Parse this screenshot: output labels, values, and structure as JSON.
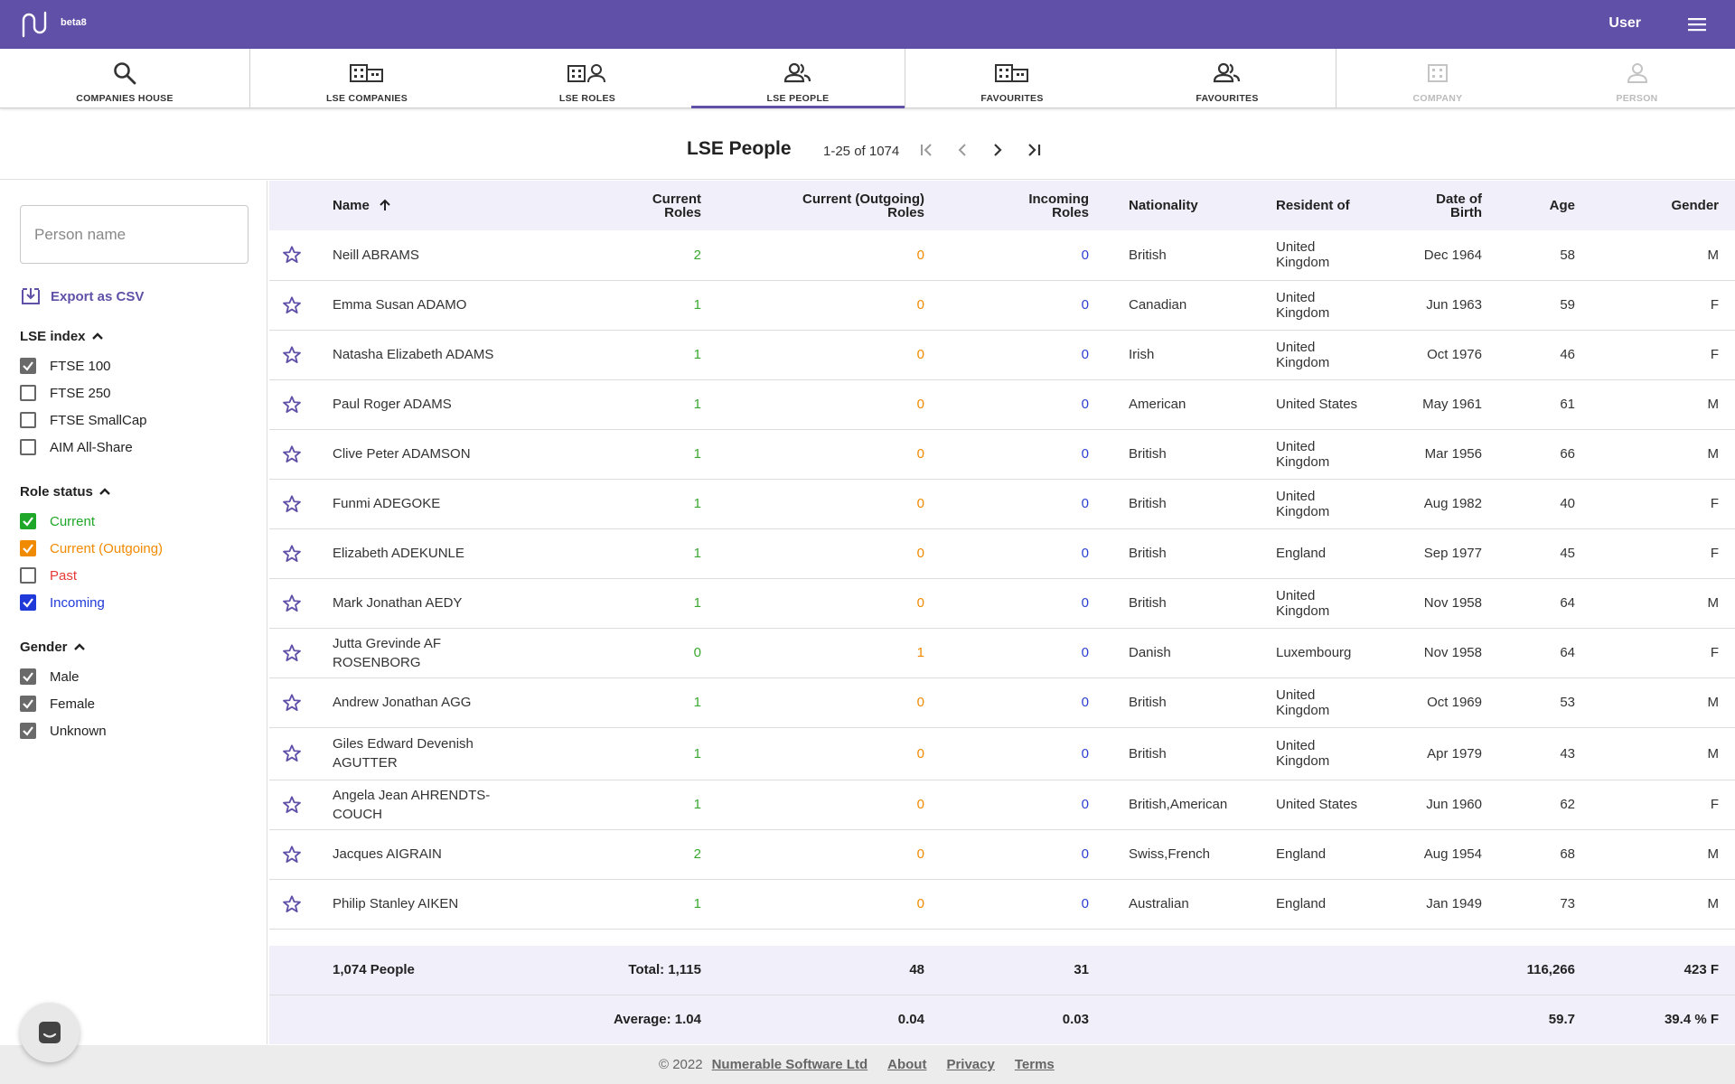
{
  "app": {
    "badge": "beta8",
    "user": "User"
  },
  "nav": {
    "tabs": [
      {
        "label": "COMPANIES HOUSE",
        "icon": "search-icon"
      },
      {
        "label": "LSE COMPANIES",
        "icon": "companies-icon"
      },
      {
        "label": "LSE ROLES",
        "icon": "company-person-icon"
      },
      {
        "label": "LSE PEOPLE",
        "icon": "people-icon",
        "active": true
      },
      {
        "label": "FAVOURITES",
        "icon": "companies-icon"
      },
      {
        "label": "FAVOURITES",
        "icon": "people-icon"
      },
      {
        "label": "COMPANY",
        "icon": "company-icon",
        "disabled": true
      },
      {
        "label": "PERSON",
        "icon": "person-icon",
        "disabled": true
      }
    ]
  },
  "page": {
    "title": "LSE People",
    "range": "1-25 of 1074"
  },
  "sidebar": {
    "search_placeholder": "Person name",
    "export_label": "Export as CSV",
    "lse_index": {
      "title": "LSE index",
      "items": [
        {
          "label": "FTSE 100",
          "checked": true
        },
        {
          "label": "FTSE 250",
          "checked": false
        },
        {
          "label": "FTSE SmallCap",
          "checked": false
        },
        {
          "label": "AIM All-Share",
          "checked": false
        }
      ]
    },
    "role_status": {
      "title": "Role status",
      "items": [
        {
          "label": "Current",
          "checked": true,
          "color": "#1fa72a"
        },
        {
          "label": "Current (Outgoing)",
          "checked": true,
          "color": "#f08a00"
        },
        {
          "label": "Past",
          "checked": false,
          "color": "#e53935"
        },
        {
          "label": "Incoming",
          "checked": true,
          "color": "#1f3ad8"
        }
      ]
    },
    "gender": {
      "title": "Gender",
      "items": [
        {
          "label": "Male",
          "checked": true
        },
        {
          "label": "Female",
          "checked": true
        },
        {
          "label": "Unknown",
          "checked": true
        }
      ]
    }
  },
  "table": {
    "headers": {
      "name": "Name",
      "current_1": "Current",
      "current_2": "Roles",
      "outgoing_1": "Current (Outgoing)",
      "outgoing_2": "Roles",
      "incoming_1": "Incoming",
      "incoming_2": "Roles",
      "nationality": "Nationality",
      "resident": "Resident of",
      "dob_1": "Date of",
      "dob_2": "Birth",
      "age": "Age",
      "gender": "Gender"
    },
    "rows": [
      {
        "name": "Neill ABRAMS",
        "current": "2",
        "outgoing": "0",
        "incoming": "0",
        "nationality": "British",
        "resident": "United Kingdom",
        "dob": "Dec 1964",
        "age": "58",
        "gender": "M"
      },
      {
        "name": "Emma Susan ADAMO",
        "current": "1",
        "outgoing": "0",
        "incoming": "0",
        "nationality": "Canadian",
        "resident": "United Kingdom",
        "dob": "Jun 1963",
        "age": "59",
        "gender": "F"
      },
      {
        "name": "Natasha Elizabeth ADAMS",
        "current": "1",
        "outgoing": "0",
        "incoming": "0",
        "nationality": "Irish",
        "resident": "United Kingdom",
        "dob": "Oct 1976",
        "age": "46",
        "gender": "F"
      },
      {
        "name": "Paul Roger ADAMS",
        "current": "1",
        "outgoing": "0",
        "incoming": "0",
        "nationality": "American",
        "resident": "United States",
        "dob": "May 1961",
        "age": "61",
        "gender": "M"
      },
      {
        "name": "Clive Peter ADAMSON",
        "current": "1",
        "outgoing": "0",
        "incoming": "0",
        "nationality": "British",
        "resident": "United Kingdom",
        "dob": "Mar 1956",
        "age": "66",
        "gender": "M"
      },
      {
        "name": "Funmi ADEGOKE",
        "current": "1",
        "outgoing": "0",
        "incoming": "0",
        "nationality": "British",
        "resident": "United Kingdom",
        "dob": "Aug 1982",
        "age": "40",
        "gender": "F"
      },
      {
        "name": "Elizabeth ADEKUNLE",
        "current": "1",
        "outgoing": "0",
        "incoming": "0",
        "nationality": "British",
        "resident": "England",
        "dob": "Sep 1977",
        "age": "45",
        "gender": "F"
      },
      {
        "name": "Mark Jonathan AEDY",
        "current": "1",
        "outgoing": "0",
        "incoming": "0",
        "nationality": "British",
        "resident": "United Kingdom",
        "dob": "Nov 1958",
        "age": "64",
        "gender": "M"
      },
      {
        "name": "Jutta Grevinde AF ROSENBORG",
        "current": "0",
        "outgoing": "1",
        "incoming": "0",
        "nationality": "Danish",
        "resident": "Luxembourg",
        "dob": "Nov 1958",
        "age": "64",
        "gender": "F"
      },
      {
        "name": "Andrew Jonathan AGG",
        "current": "1",
        "outgoing": "0",
        "incoming": "0",
        "nationality": "British",
        "resident": "United Kingdom",
        "dob": "Oct 1969",
        "age": "53",
        "gender": "M"
      },
      {
        "name": "Giles Edward Devenish AGUTTER",
        "current": "1",
        "outgoing": "0",
        "incoming": "0",
        "nationality": "British",
        "resident": "United Kingdom",
        "dob": "Apr 1979",
        "age": "43",
        "gender": "M",
        "tall": true
      },
      {
        "name": "Angela Jean AHRENDTS-COUCH",
        "current": "1",
        "outgoing": "0",
        "incoming": "0",
        "nationality": "British,American",
        "resident": "United States",
        "dob": "Jun 1960",
        "age": "62",
        "gender": "F"
      },
      {
        "name": "Jacques AIGRAIN",
        "current": "2",
        "outgoing": "0",
        "incoming": "0",
        "nationality": "Swiss,French",
        "resident": "England",
        "dob": "Aug 1954",
        "age": "68",
        "gender": "M"
      },
      {
        "name": "Philip Stanley AIKEN",
        "current": "1",
        "outgoing": "0",
        "incoming": "0",
        "nationality": "Australian",
        "resident": "England",
        "dob": "Jan 1949",
        "age": "73",
        "gender": "M"
      }
    ],
    "totals": {
      "people": "1,074 People",
      "current": "Total: 1,115",
      "outgoing": "48",
      "incoming": "31",
      "age": "116,266",
      "gender": "423 F"
    },
    "averages": {
      "current": "Average: 1.04",
      "outgoing": "0.04",
      "incoming": "0.03",
      "age": "59.7",
      "gender": "39.4 % F"
    }
  },
  "footer": {
    "copyright": "© 2022",
    "company": "Numerable Software Ltd",
    "about": "About",
    "privacy": "Privacy",
    "terms": "Terms"
  }
}
